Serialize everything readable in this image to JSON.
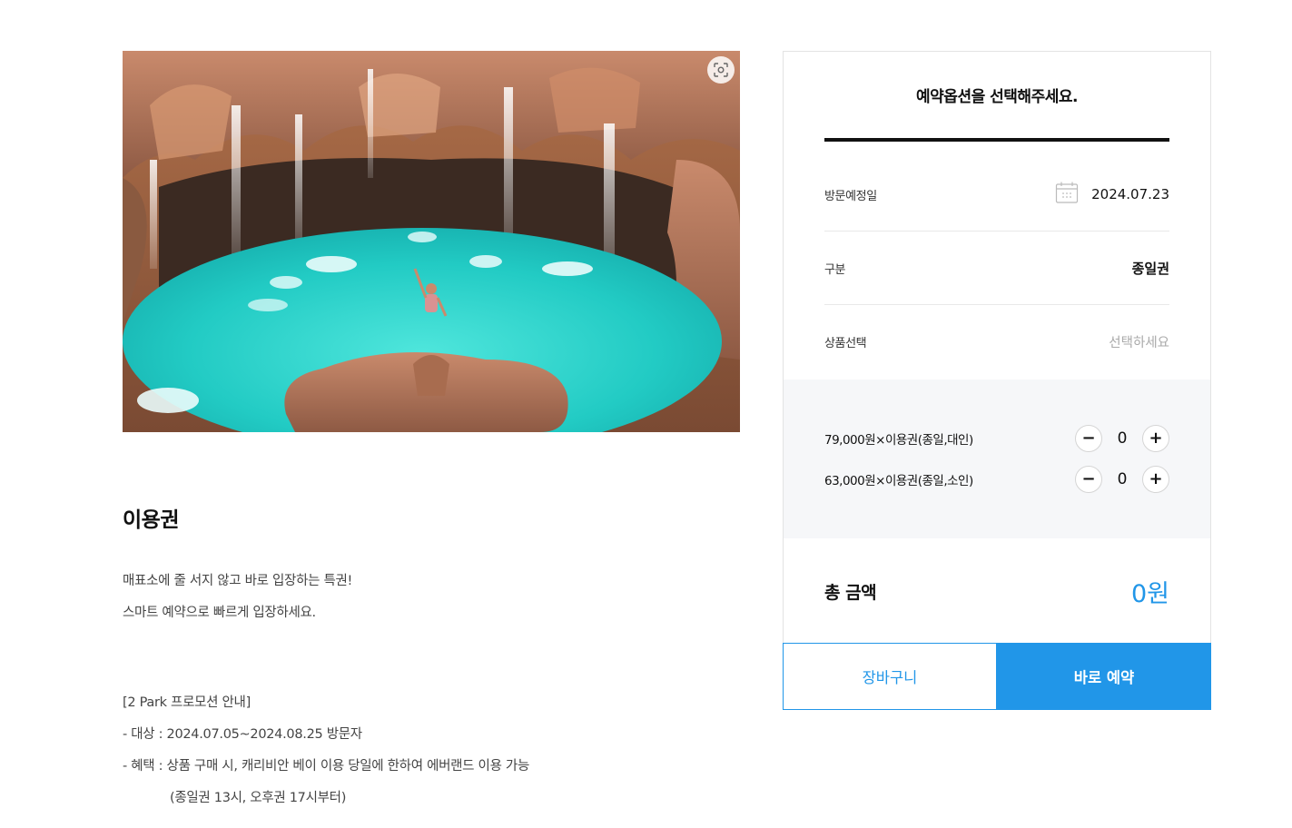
{
  "main": {
    "product": {
      "title": "이용권",
      "description": [
        "매표소에 줄 서지 않고 바로 입장하는 특권!",
        "스마트 예약으로 빠르게 입장하세요."
      ],
      "promo": [
        "[2 Park 프로모션 안내]",
        "- 대상 : 2024.07.05~2024.08.25 방문자",
        "- 혜택 : 상품 구매 시, 캐리비안 베이 이용 당일에 한하여 에버랜드 이용 가능",
        "(종일권 13시, 오후권 17시부터)"
      ],
      "image_icon": "zoom-scan-icon"
    }
  },
  "booking": {
    "header": "예약옵션을 선택해주세요.",
    "visit_date_label": "방문예정일",
    "visit_date_value": "2024.07.23",
    "calendar_icon": "calendar-icon",
    "category_label": "구분",
    "category_value": "종일권",
    "product_select_label": "상품선택",
    "product_select_placeholder": "선택하세요",
    "options": [
      {
        "label": "79,000원×이용권(종일,대인)",
        "qty": "0"
      },
      {
        "label": "63,000원×이용권(종일,소인)",
        "qty": "0"
      }
    ],
    "minus_symbol": "−",
    "plus_symbol": "+",
    "total_label": "총 금액",
    "total_amount": "0",
    "total_unit": "원",
    "cart_button": "장바구니",
    "book_button": "바로 예약"
  },
  "colors": {
    "accent": "#2196e8",
    "qty_bg": "#f6f7f9",
    "border": "#e3e3e3"
  }
}
